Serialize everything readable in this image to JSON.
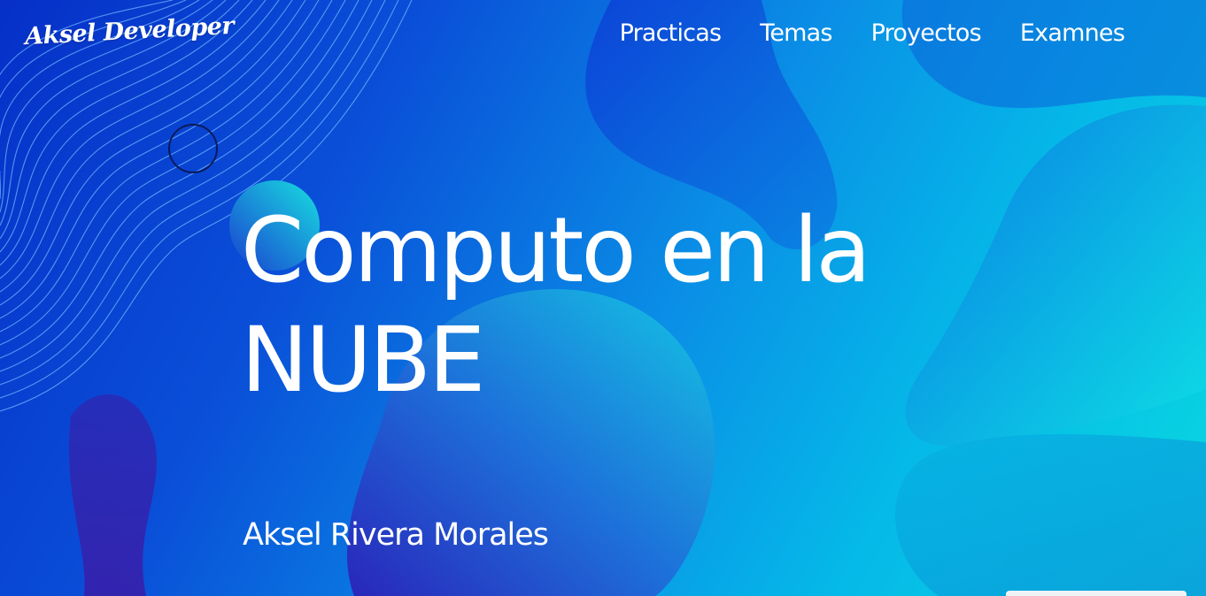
{
  "brand": {
    "logo_text": "Aksel Developer"
  },
  "nav": {
    "items": [
      {
        "label": "Practicas"
      },
      {
        "label": "Temas"
      },
      {
        "label": "Proyectos"
      },
      {
        "label": "Examnes"
      }
    ]
  },
  "hero": {
    "title_line1": "Computo en la",
    "title_line2": "NUBE",
    "author": "Aksel Rivera Morales"
  },
  "colors": {
    "background_start": "#0630c8",
    "background_end": "#0ad8e0",
    "text": "#ffffff",
    "ring_outline": "#0a1a5a"
  }
}
